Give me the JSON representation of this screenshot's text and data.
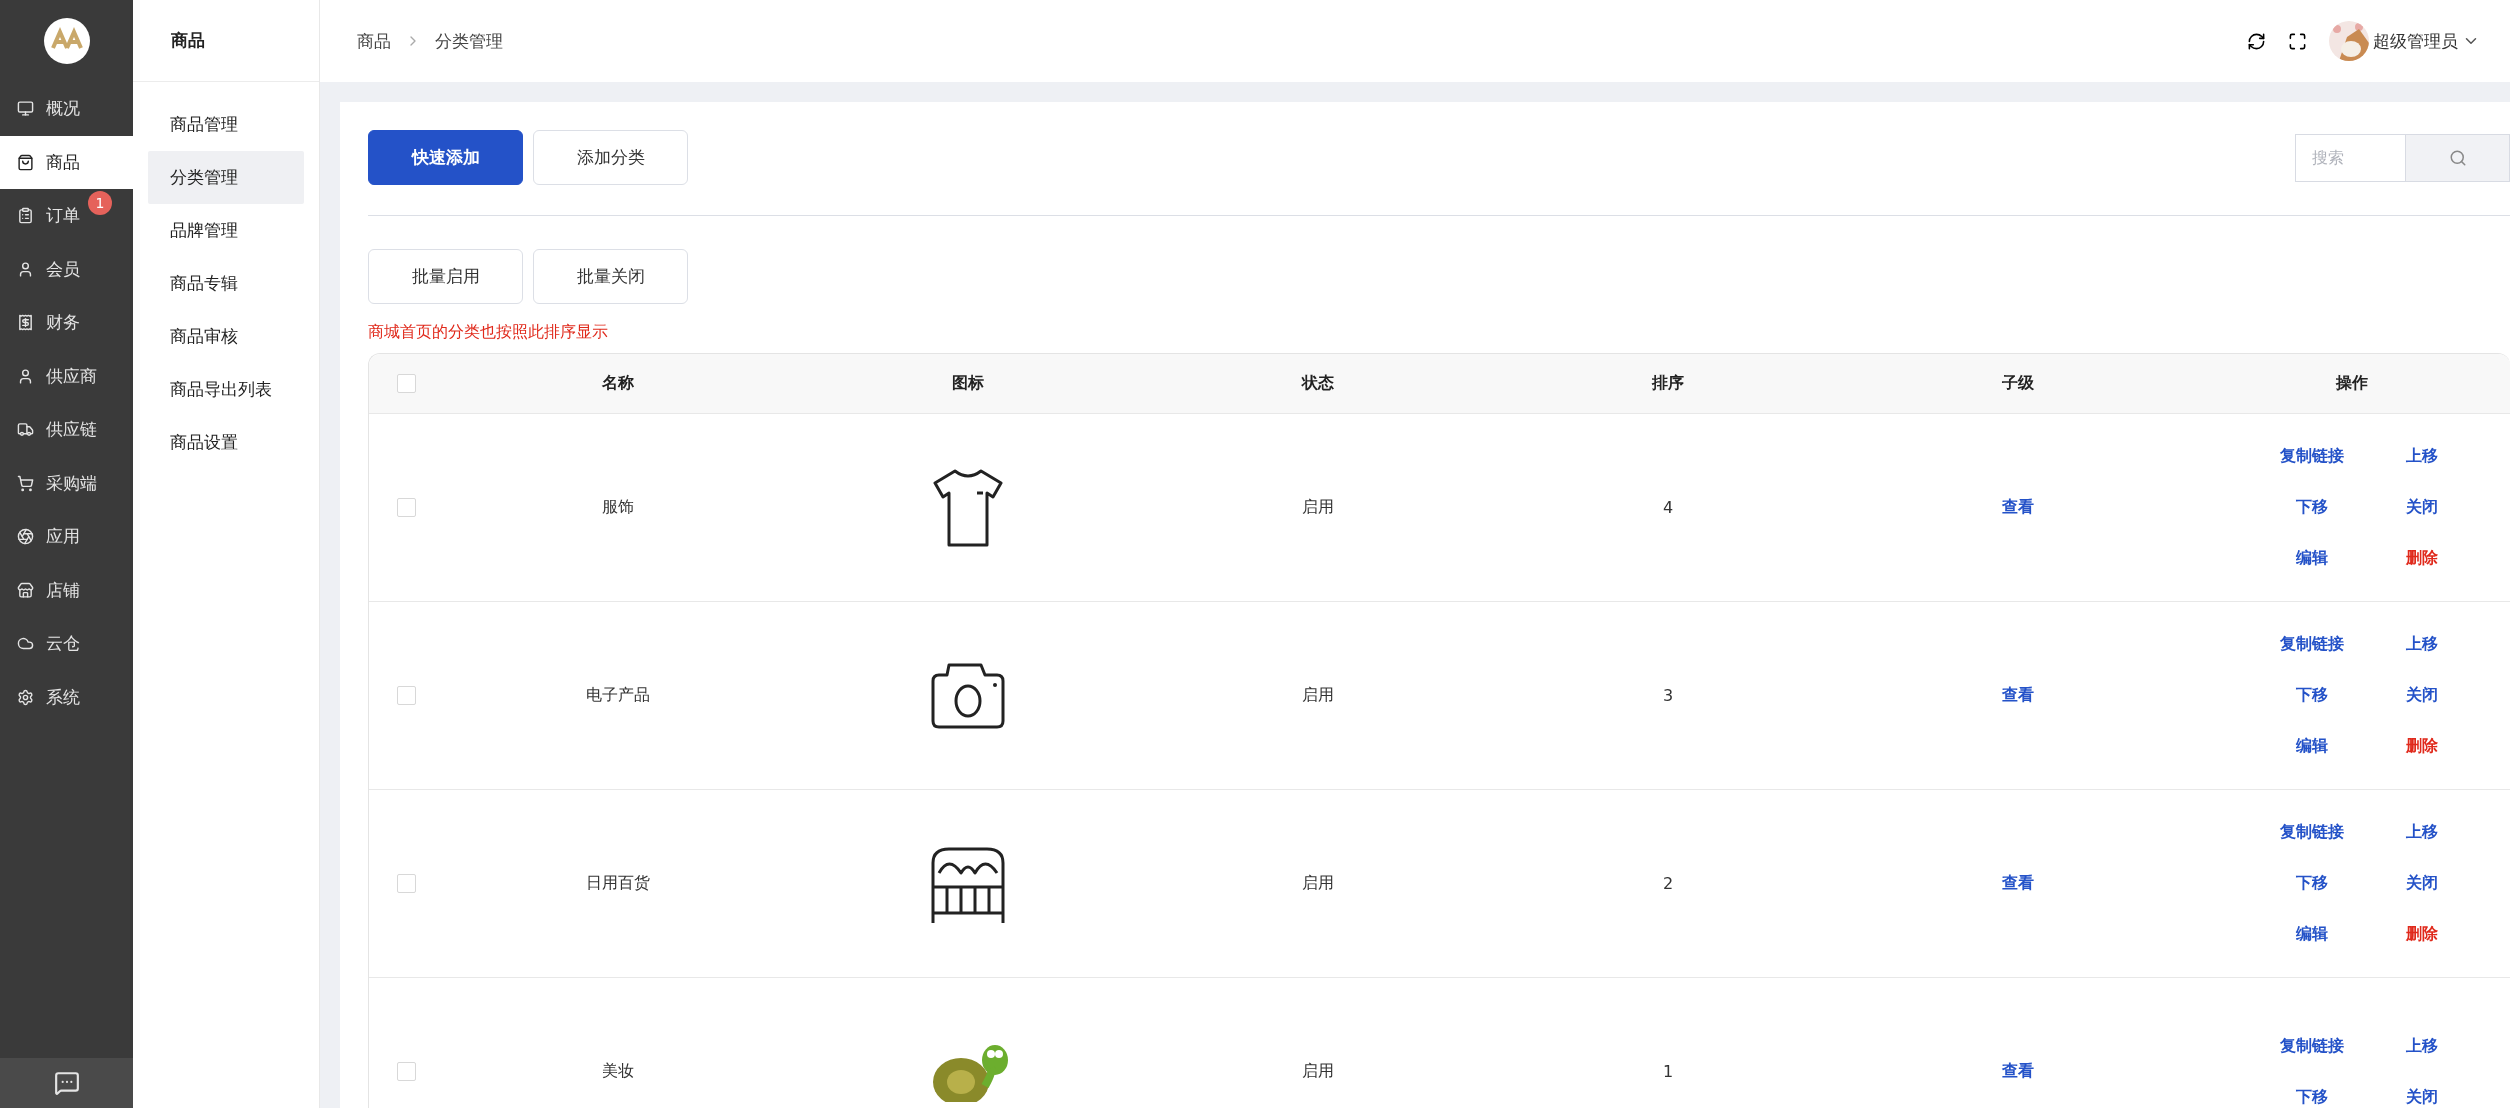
{
  "sidebar": {
    "items": [
      {
        "label": "概况",
        "selected": false
      },
      {
        "label": "商品",
        "selected": true
      },
      {
        "label": "订单",
        "selected": false,
        "badge": "1"
      },
      {
        "label": "会员",
        "selected": false
      },
      {
        "label": "财务",
        "selected": false
      },
      {
        "label": "供应商",
        "selected": false
      },
      {
        "label": "供应链",
        "selected": false
      },
      {
        "label": "采购端",
        "selected": false
      },
      {
        "label": "应用",
        "selected": false
      },
      {
        "label": "店铺",
        "selected": false
      },
      {
        "label": "云仓",
        "selected": false
      },
      {
        "label": "系统",
        "selected": false
      }
    ]
  },
  "submenu": {
    "title": "商品",
    "items": [
      {
        "label": "商品管理",
        "selected": false
      },
      {
        "label": "分类管理",
        "selected": true
      },
      {
        "label": "品牌管理",
        "selected": false
      },
      {
        "label": "商品专辑",
        "selected": false
      },
      {
        "label": "商品审核",
        "selected": false
      },
      {
        "label": "商品导出列表",
        "selected": false
      },
      {
        "label": "商品设置",
        "selected": false
      }
    ]
  },
  "breadcrumb": [
    "商品",
    "分类管理"
  ],
  "user": {
    "name": "超级管理员"
  },
  "toolbar": {
    "buttons": [
      {
        "label": "快速添加",
        "kind": "primary"
      },
      {
        "label": "添加分类",
        "kind": "default"
      }
    ],
    "search": {
      "placeholder": "搜索"
    }
  },
  "batch_buttons": [
    "批量启用",
    "批量关闭"
  ],
  "note": "商城首页的分类也按照此排序显示",
  "table": {
    "header_checkbox": {
      "checked": false
    },
    "columns": [
      "名称",
      "图标",
      "状态",
      "排序",
      "子级",
      "操作"
    ],
    "rows": [
      {
        "checked": false,
        "name": "服饰",
        "status": "启用",
        "sort": "4",
        "child": "查看",
        "actions": [
          {
            "label": "复制链接",
            "kind": "link"
          },
          {
            "label": "上移",
            "kind": "link"
          },
          {
            "label": "下移",
            "kind": "link"
          },
          {
            "label": "关闭",
            "kind": "link"
          },
          {
            "label": "编辑",
            "kind": "link"
          },
          {
            "label": "删除",
            "kind": "danger"
          }
        ]
      },
      {
        "checked": false,
        "name": "电子产品",
        "status": "启用",
        "sort": "3",
        "child": "查看",
        "actions": [
          {
            "label": "复制链接",
            "kind": "link"
          },
          {
            "label": "上移",
            "kind": "link"
          },
          {
            "label": "下移",
            "kind": "link"
          },
          {
            "label": "关闭",
            "kind": "link"
          },
          {
            "label": "编辑",
            "kind": "link"
          },
          {
            "label": "删除",
            "kind": "danger"
          }
        ]
      },
      {
        "checked": false,
        "name": "日用百货",
        "status": "启用",
        "sort": "2",
        "child": "查看",
        "actions": [
          {
            "label": "复制链接",
            "kind": "link"
          },
          {
            "label": "上移",
            "kind": "link"
          },
          {
            "label": "下移",
            "kind": "link"
          },
          {
            "label": "关闭",
            "kind": "link"
          },
          {
            "label": "编辑",
            "kind": "link"
          },
          {
            "label": "删除",
            "kind": "danger"
          }
        ]
      },
      {
        "checked": false,
        "name": "美妆",
        "status": "启用",
        "sort": "1",
        "child": "查看",
        "actions": [
          {
            "label": "复制链接",
            "kind": "link"
          },
          {
            "label": "上移",
            "kind": "link"
          },
          {
            "label": "下移",
            "kind": "link"
          },
          {
            "label": "关闭",
            "kind": "link"
          }
        ]
      }
    ]
  }
}
